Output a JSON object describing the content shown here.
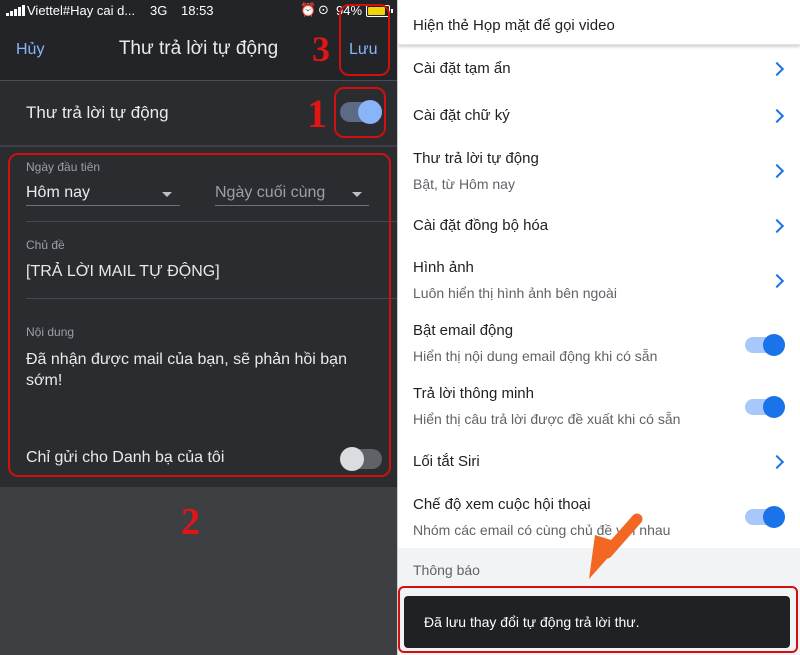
{
  "status_bar": {
    "carrier": "Viettel#Hay cai d...",
    "network": "3G",
    "time": "18:53",
    "battery": "94%",
    "battery_level": 0.94,
    "battery_color": "#f2d20a"
  },
  "nav": {
    "cancel": "Hủy",
    "title": "Thư trả lời tự động",
    "save": "Lưu"
  },
  "auto_reply": {
    "label": "Thư trả lời tự động",
    "enabled": true
  },
  "form": {
    "first_day_label": "Ngày đầu tiên",
    "first_day_value": "Hôm nay",
    "last_day_placeholder": "Ngày cuối cùng",
    "subject_label": "Chủ đề",
    "subject_value": "[TRẢ LỜI MAIL TỰ ĐỘNG]",
    "body_label": "Nội dung",
    "body_value": "Đã nhận được mail của bạn, sẽ phản hồi bạn sớm!",
    "contacts_only_label": "Chỉ gửi cho Danh bạ của tôi",
    "contacts_only_enabled": false
  },
  "annotations": {
    "n1": "1",
    "n2": "2",
    "n3": "3",
    "color": "#d01010"
  },
  "settings": {
    "rows": [
      {
        "title": "Hiện thẻ Họp mặt để gọi video"
      },
      {
        "title": "Cài đặt tạm ẩn"
      },
      {
        "title": "Cài đặt chữ ký"
      },
      {
        "title": "Thư trả lời tự động",
        "subtitle": "Bật, từ Hôm nay"
      },
      {
        "title": "Cài đặt đồng bộ hóa"
      },
      {
        "title": "Hình ảnh",
        "subtitle": "Luôn hiển thị hình ảnh bên ngoài"
      },
      {
        "title": "Bật email động",
        "subtitle": "Hiển thị nội dung email động khi có sẵn",
        "toggle": true
      },
      {
        "title": "Trả lời thông minh",
        "subtitle": "Hiển thị câu trả lời được đề xuất khi có sẵn",
        "toggle": true
      },
      {
        "title": "Lối tắt Siri"
      },
      {
        "title": "Chế độ xem cuộc hội thoại",
        "subtitle": "Nhóm các email có cùng chủ đề với nhau",
        "toggle": true
      }
    ],
    "section_header": "Thông báo"
  },
  "snackbar": {
    "message": "Đã lưu thay đổi tự động trả lời thư."
  },
  "colors": {
    "accent_dark": "#8ab4f8",
    "accent_light": "#1a73e8",
    "annotation_red": "#d01010",
    "arrow_orange": "#f26722"
  }
}
